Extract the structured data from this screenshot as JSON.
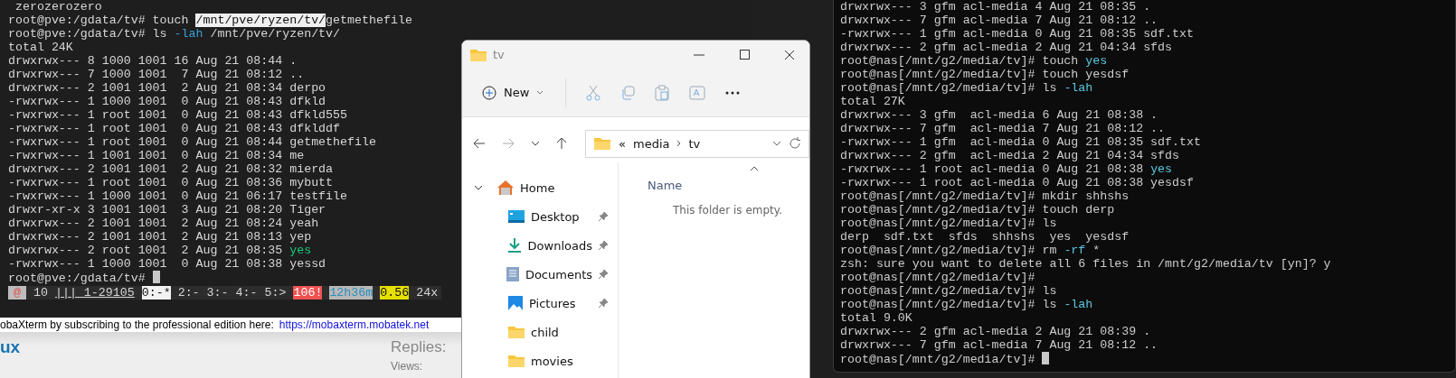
{
  "left_terminal": {
    "lines": [
      {
        "text": " zerozerozero"
      },
      {
        "segments": [
          {
            "text": "root@pve:/gdata/tv# touch ",
            "kind": "plain"
          },
          {
            "text": "/mnt/pve/ryzen/tv/",
            "kind": "selected"
          },
          {
            "text": "getmethefile",
            "kind": "plain"
          }
        ]
      },
      {
        "segments": [
          {
            "text": "root@pve:/gdata/tv# ls ",
            "kind": "plain"
          },
          {
            "text": "-lah",
            "kind": "cyan"
          },
          {
            "text": " /mnt/pve/ryzen/tv/",
            "kind": "plain"
          }
        ]
      },
      {
        "text": "total 24K"
      },
      {
        "text": "drwxrwx--- 8 1000 1001 16 Aug 21 08:44 ."
      },
      {
        "text": "drwxrwx--- 7 1000 1001  7 Aug 21 08:12 .."
      },
      {
        "text": "drwxrwx--- 2 1001 1001  2 Aug 21 08:34 derpo"
      },
      {
        "text": "-rwxrwx--- 1 1000 1001  0 Aug 21 08:43 dfkld"
      },
      {
        "text": "-rwxrwx--- 1 root 1001  0 Aug 21 08:43 dfkld555"
      },
      {
        "text": "-rwxrwx--- 1 root 1001  0 Aug 21 08:43 dfklddf"
      },
      {
        "text": "-rwxrwx--- 1 root 1001  0 Aug 21 08:44 getmethefile"
      },
      {
        "text": "-rwxrwx--- 1 1001 1001  0 Aug 21 08:34 me"
      },
      {
        "text": "drwxrwx--- 2 1001 1001  2 Aug 21 08:32 mierda"
      },
      {
        "text": "-rwxrwx--- 1 root 1001  0 Aug 21 08:36 mybutt"
      },
      {
        "text": "-rwxrwx--- 1 1000 1001  0 Aug 21 06:17 testfile"
      },
      {
        "text": "drwxr-xr-x 3 1001 1001  3 Aug 21 08:20 Tiger"
      },
      {
        "text": "drwxrwx--- 2 1001 1001  2 Aug 21 08:24 yeah"
      },
      {
        "text": "drwxrwx--- 2 1001 1001  2 Aug 21 08:13 yep"
      },
      {
        "segments": [
          {
            "text": "drwxrwx--- 2 root 1001  2 Aug 21 08:35 ",
            "kind": "plain"
          },
          {
            "text": "yes",
            "kind": "green"
          }
        ]
      },
      {
        "text": "-rwxrwx--- 1 1000 1001  0 Aug 21 08:38 yessd"
      },
      {
        "text": "root@pve:/gdata/tv# "
      }
    ],
    "status_bar": [
      {
        "text": "@",
        "kind": "host"
      },
      {
        "text": "10",
        "kind": "plain"
      },
      {
        "text": "||| 1-29105",
        "kind": "window"
      },
      {
        "text": "0:-*",
        "kind": "active"
      },
      {
        "text": "2:-",
        "kind": "plain"
      },
      {
        "text": "3:-",
        "kind": "plain"
      },
      {
        "text": "4:-",
        "kind": "plain"
      },
      {
        "text": "5:>",
        "kind": "plain"
      },
      {
        "text": "106!",
        "kind": "alert"
      },
      {
        "text": "12h36m",
        "kind": "time"
      },
      {
        "text": "0.56",
        "kind": "load"
      },
      {
        "text": "24x",
        "kind": "plain"
      }
    ]
  },
  "banner": {
    "text": "obaXterm by subscribing to the professional edition here:",
    "link": "https://mobaxterm.mobatek.net"
  },
  "forum": {
    "title": "ux",
    "replies_label": "Replies:",
    "views_label": "Views:"
  },
  "explorer": {
    "title": "tv",
    "new_button": "New",
    "overflow": "«",
    "breadcrumb": [
      "media",
      "tv"
    ],
    "sidebar": [
      {
        "label": "Home",
        "kind": "home",
        "expanded": true,
        "pinned": false
      },
      {
        "label": "Desktop",
        "kind": "desktop",
        "pinned": true
      },
      {
        "label": "Downloads",
        "kind": "downloads",
        "pinned": true
      },
      {
        "label": "Documents",
        "kind": "documents",
        "pinned": true
      },
      {
        "label": "Pictures",
        "kind": "pictures",
        "pinned": true
      },
      {
        "label": "child",
        "kind": "folder",
        "pinned": false
      },
      {
        "label": "movies",
        "kind": "folder",
        "pinned": false
      }
    ],
    "column": "Name",
    "empty_message": "This folder is empty."
  },
  "right_terminal": {
    "lines": [
      {
        "text": "drwxrwx--- 3 gfm acl-media 4 Aug 21 08:35 ."
      },
      {
        "text": "drwxrwx--- 7 gfm acl-media 7 Aug 21 08:12 .."
      },
      {
        "text": "-rwxrwx--- 1 gfm acl-media 0 Aug 21 08:35 sdf.txt"
      },
      {
        "text": "drwxrwx--- 2 gfm acl-media 2 Aug 21 04:34 sfds"
      },
      {
        "segments": [
          {
            "text": "root@nas[/mnt/g2/media/tv]# touch ",
            "kind": "plain"
          },
          {
            "text": "yes",
            "kind": "cyan"
          }
        ]
      },
      {
        "text": "root@nas[/mnt/g2/media/tv]# touch yesdsf"
      },
      {
        "segments": [
          {
            "text": "root@nas[/mnt/g2/media/tv]# ls ",
            "kind": "plain"
          },
          {
            "text": "-lah",
            "kind": "cyan"
          }
        ]
      },
      {
        "text": "total 27K"
      },
      {
        "text": "drwxrwx--- 3 gfm  acl-media 6 Aug 21 08:38 ."
      },
      {
        "text": "drwxrwx--- 7 gfm  acl-media 7 Aug 21 08:12 .."
      },
      {
        "text": "-rwxrwx--- 1 gfm  acl-media 0 Aug 21 08:35 sdf.txt"
      },
      {
        "text": "drwxrwx--- 2 gfm  acl-media 2 Aug 21 04:34 sfds"
      },
      {
        "segments": [
          {
            "text": "-rwxrwx--- 1 root acl-media 0 Aug 21 08:38 ",
            "kind": "plain"
          },
          {
            "text": "yes",
            "kind": "cyan"
          }
        ]
      },
      {
        "text": "-rwxrwx--- 1 root acl-media 0 Aug 21 08:38 yesdsf"
      },
      {
        "text": "root@nas[/mnt/g2/media/tv]# mkdir shhshs"
      },
      {
        "text": "root@nas[/mnt/g2/media/tv]# touch derp"
      },
      {
        "text": "root@nas[/mnt/g2/media/tv]# ls"
      },
      {
        "text": "derp  sdf.txt  sfds  shhshs  yes  yesdsf"
      },
      {
        "segments": [
          {
            "text": "root@nas[/mnt/g2/media/tv]# rm ",
            "kind": "plain"
          },
          {
            "text": "-rf",
            "kind": "cyan"
          },
          {
            "text": " *",
            "kind": "plain"
          }
        ]
      },
      {
        "text": "zsh: sure you want to delete all 6 files in /mnt/g2/media/tv [yn]? y"
      },
      {
        "text": "root@nas[/mnt/g2/media/tv]#"
      },
      {
        "text": "root@nas[/mnt/g2/media/tv]# ls"
      },
      {
        "segments": [
          {
            "text": "root@nas[/mnt/g2/media/tv]# ls ",
            "kind": "plain"
          },
          {
            "text": "-lah",
            "kind": "cyan"
          }
        ]
      },
      {
        "text": "total 9.0K"
      },
      {
        "text": "drwxrwx--- 2 gfm acl-media 2 Aug 21 08:39 ."
      },
      {
        "text": "drwxrwx--- 7 gfm acl-media 7 Aug 21 08:12 .."
      },
      {
        "text": "root@nas[/mnt/g2/media/tv]# "
      }
    ]
  }
}
